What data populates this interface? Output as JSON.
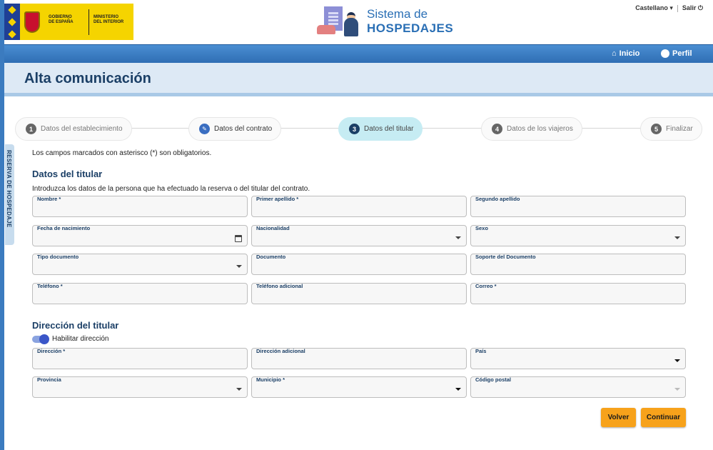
{
  "header": {
    "logo": {
      "line1": "GOBIERNO",
      "line2": "DE ESPAÑA",
      "line3": "MINISTERIO",
      "line4": "DEL INTERIOR"
    },
    "brand": {
      "line1": "Sistema de",
      "line2": "HOSPEDAJES"
    },
    "language": "Castellano",
    "logout": "Salir"
  },
  "nav": {
    "home": "Inicio",
    "profile": "Perfil"
  },
  "page_title": "Alta comunicación",
  "side_tab": "RESERVA DE HOSPEDAJE",
  "steps": [
    {
      "num": "1",
      "label": "Datos del establecimiento",
      "state": "default"
    },
    {
      "num": "",
      "label": "Datos del contrato",
      "state": "done"
    },
    {
      "num": "3",
      "label": "Datos del titular",
      "state": "active"
    },
    {
      "num": "4",
      "label": "Datos de los viajeros",
      "state": "default"
    },
    {
      "num": "5",
      "label": "Finalizar",
      "state": "default"
    }
  ],
  "required_note": "Los campos marcados con asterisco (*) son obligatorios.",
  "holder_section": {
    "title": "Datos del titular",
    "subtitle": "Introduzca los datos de la persona que ha efectuado la reserva o del titular del contrato.",
    "fields": {
      "nombre": "Nombre *",
      "primer_apellido": "Primer apellido *",
      "segundo_apellido": "Segundo apellido",
      "fecha_nacimiento": "Fecha de nacimiento",
      "nacionalidad": "Nacionalidad",
      "sexo": "Sexo",
      "tipo_documento": "Tipo documento",
      "documento": "Documento",
      "soporte_documento": "Soporte del Documento",
      "telefono": "Teléfono *",
      "telefono_adicional": "Teléfono adicional",
      "correo": "Correo *"
    }
  },
  "address_section": {
    "title": "Dirección del titular",
    "toggle_label": "Habilitar dirección",
    "toggle_on": true,
    "fields": {
      "direccion": "Dirección *",
      "direccion_adicional": "Dirección adicional",
      "pais": "País",
      "provincia": "Provincia",
      "municipio": "Municipio *",
      "codigo_postal": "Código postal"
    }
  },
  "buttons": {
    "back": "Volver",
    "continue": "Continuar"
  },
  "colors": {
    "accent": "#1b3f66",
    "navbar": "#3b7bbf",
    "button": "#f7a21b",
    "active_step": "#c6ecf3"
  }
}
